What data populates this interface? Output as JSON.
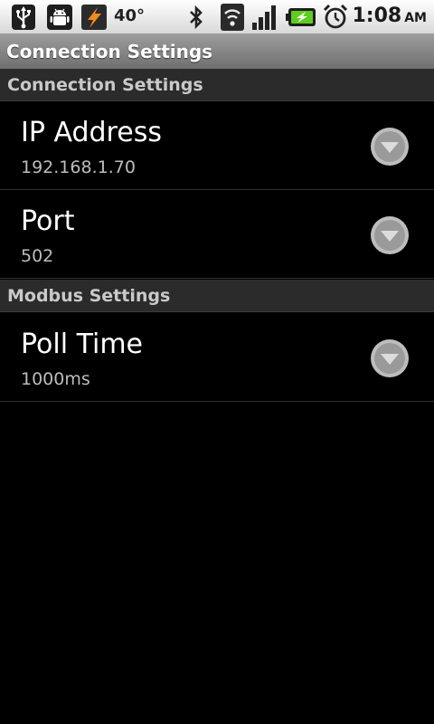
{
  "status_bar": {
    "temperature": "40°",
    "time": "1:08",
    "ampm": "AM",
    "icons": [
      "usb-icon",
      "android-debug-icon",
      "app-notification-icon",
      "bluetooth-icon",
      "wifi-icon",
      "signal-icon",
      "battery-charging-icon",
      "alarm-icon"
    ]
  },
  "title_bar": {
    "title": "Connection Settings"
  },
  "categories": [
    {
      "label": "Connection Settings",
      "items": [
        {
          "title": "IP Address",
          "summary": "192.168.1.70"
        },
        {
          "title": "Port",
          "summary": "502"
        }
      ]
    },
    {
      "label": "Modbus Settings",
      "items": [
        {
          "title": "Poll Time",
          "summary": "1000ms"
        }
      ]
    }
  ]
}
